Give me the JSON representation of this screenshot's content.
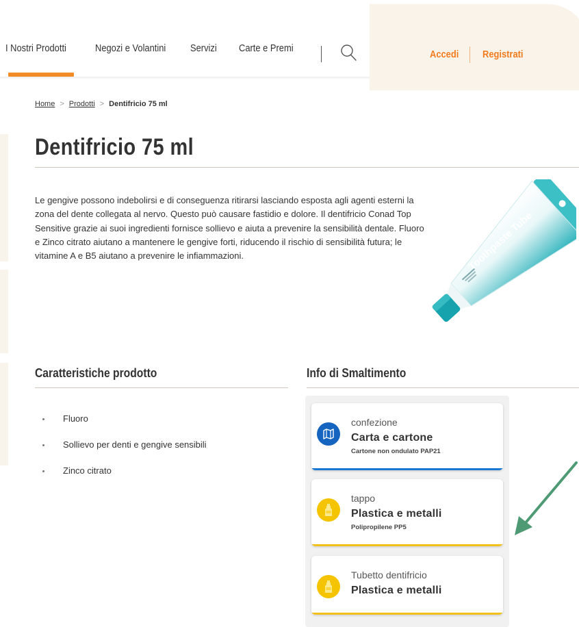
{
  "nav": {
    "items": [
      {
        "label": "I Nostri Prodotti"
      },
      {
        "label": "Negozi e Volantini"
      },
      {
        "label": "Servizi"
      },
      {
        "label": "Carte e Premi"
      }
    ],
    "search_icon": "search-icon"
  },
  "account": {
    "login": "Accedi",
    "register": "Registrati"
  },
  "breadcrumb": {
    "home": "Home",
    "products": "Prodotti",
    "current": "Dentifricio 75 ml"
  },
  "product": {
    "title": "Dentifricio 75 ml",
    "description": "Le gengive possono indebolirsi e di conseguenza ritirarsi lasciando esposta agli agenti esterni la zona del dente collegata al nervo. Questo può causare fastidio e dolore. Il dentifricio Conad Top Sensitive grazie ai suoi ingredienti fornisce sollievo e aiuta a prevenire la sensibilità dentale. Fluoro e Zinco citrato aiutano a mantenere le gengive forti, riducendo il rischio di sensibilità futura; le vitamine A e B5 aiutano a prevenire le infiammazioni.",
    "image_label": "Toothpaste Tube"
  },
  "features": {
    "title": "Caratteristiche prodotto",
    "items": [
      {
        "label": "Fluoro"
      },
      {
        "label": "Sollievo per denti e gengive sensibili"
      },
      {
        "label": "Zinco citrato"
      }
    ]
  },
  "disposal": {
    "title": "Info di Smaltimento",
    "cards": [
      {
        "type": "confezione",
        "material": "Carta e cartone",
        "detail": "Cartone non ondulato PAP21",
        "icon": "paper-map-icon",
        "color": "#1565c0",
        "accent": "#1976d2"
      },
      {
        "type": "tappo",
        "material": "Plastica e metalli",
        "detail": "Polipropilene PP5",
        "icon": "plastic-bottle-icon",
        "color": "#f5c400",
        "accent": "#f2c21b"
      },
      {
        "type": "Tubetto dentifricio",
        "material": "Plastica e metalli",
        "detail": "",
        "icon": "plastic-bottle-icon",
        "color": "#f5c400",
        "accent": "#f2c21b"
      }
    ]
  },
  "colors": {
    "brand_orange": "#f07c1e",
    "account_bg": "#faf3ea",
    "arrow_green": "#4e9a74",
    "tube_teal": "#3bbfc4"
  }
}
